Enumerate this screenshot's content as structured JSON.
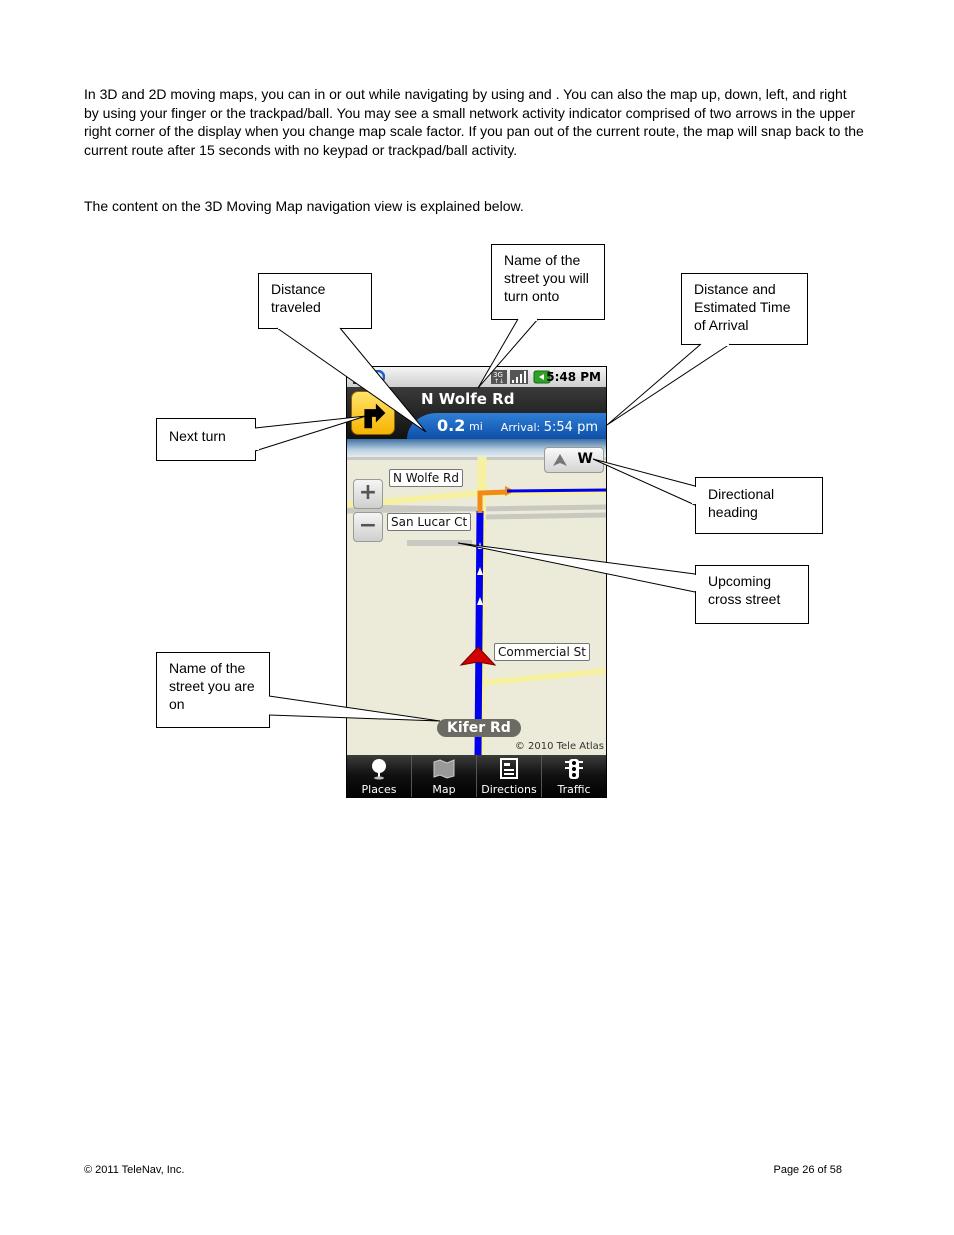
{
  "document": {
    "intro_paragraph": "In 3D and 2D moving maps, you can            in or out while navigating by using    and   . You can also         the map up, down, left, and right by using your finger or the trackpad/ball. You may see a small network activity indicator comprised of two arrows in the upper right corner of the display when you change map scale factor. If you pan out of the current route, the map will snap back to the current route after 15 seconds with no keypad or trackpad/ball activity.",
    "lead_sentence": "The content on the 3D Moving Map navigation view is explained below.",
    "footer_left": "© 2011 TeleNav, Inc.",
    "footer_right": "Page 26 of 58"
  },
  "callouts": {
    "distance_traveled": "Distance traveled",
    "turn_street": "Name of the street you will turn onto",
    "eta": "Distance and Estimated Time of Arrival",
    "next_turn": "Next turn",
    "directional_heading": "Directional heading",
    "upcoming_cross": "Upcoming cross street",
    "current_street": "Name of the street you are on"
  },
  "phone": {
    "status_time": "5:48 PM",
    "status_icons": [
      "download-icon",
      "sync-icon",
      "3g-icon",
      "signal-icon",
      "battery-icon"
    ],
    "next_street": "N Wolfe Rd",
    "distance_value": "0.2",
    "distance_unit": "mi",
    "arrival_label": "Arrival:",
    "arrival_time": "5:54 pm",
    "heading": "W",
    "zoom_in": "+",
    "zoom_out": "−",
    "map_labels": {
      "wolfe": "N Wolfe Rd",
      "san_lucar": "San Lucar Ct",
      "commercial": "Commercial St"
    },
    "current_street": "Kifer Rd",
    "map_credit": "© 2010 Tele Atlas",
    "colors": {
      "route": "#0000ee",
      "turn": "#f08a1a",
      "road": "#f6f0a0",
      "map_bg": "#ecebd9",
      "nav_blue": "#1a62c0"
    },
    "tabs": [
      {
        "label": "Places",
        "icon": "pin-icon"
      },
      {
        "label": "Map",
        "icon": "map-icon"
      },
      {
        "label": "Directions",
        "icon": "directions-list-icon"
      },
      {
        "label": "Traffic",
        "icon": "traffic-light-icon"
      }
    ]
  }
}
